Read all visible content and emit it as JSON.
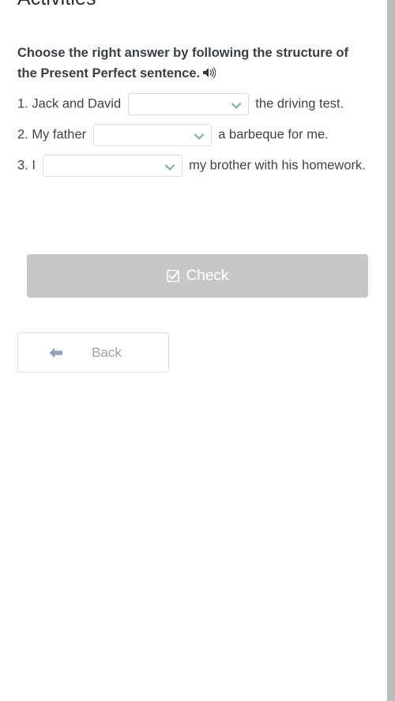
{
  "page": {
    "title": "Activities",
    "background_color": "#ffffff"
  },
  "instruction": {
    "text": "Choose the right answer by following the structure of the Present Perfect sentence.",
    "audio_icon": "speaker-icon"
  },
  "questions": [
    {
      "number": "1.",
      "prefix": "1. Jack and David ",
      "suffix": " the driving test.",
      "dropdown": {
        "name": "answer-select-1",
        "value": "",
        "chevron_color": "#8fb3b0"
      }
    },
    {
      "number": "2.",
      "prefix": "2. My father ",
      "suffix": " a barbeque for me.",
      "dropdown": {
        "name": "answer-select-2",
        "value": "",
        "chevron_color": "#8fb3b0"
      }
    },
    {
      "number": "3.",
      "prefix": "3. I ",
      "suffix": " my brother with his homework.",
      "dropdown": {
        "name": "answer-select-3",
        "value": "",
        "chevron_color": "#8fb3b0"
      }
    }
  ],
  "buttons": {
    "check": {
      "label": "Check",
      "icon": "checkbox-checked-icon",
      "background_color": "#c7c7c7",
      "text_color": "#ffffff",
      "disabled": true
    },
    "back": {
      "label": "Back",
      "icon": "arrow-left-icon",
      "background_color": "#ffffff",
      "text_color": "#9aa3ab",
      "border_color": "#e0e0e0"
    }
  },
  "scrollbar": {
    "thumb_color": "#bcbcbc",
    "orientation": "vertical"
  },
  "colors": {
    "heading": "#2b2b2b",
    "instruction": "#3a3f44",
    "body_text": "#3f4448",
    "select_border": "#dcdcdc",
    "accent_teal": "#8fb3b0",
    "arrow_blue_gray": "#90a4b4"
  }
}
